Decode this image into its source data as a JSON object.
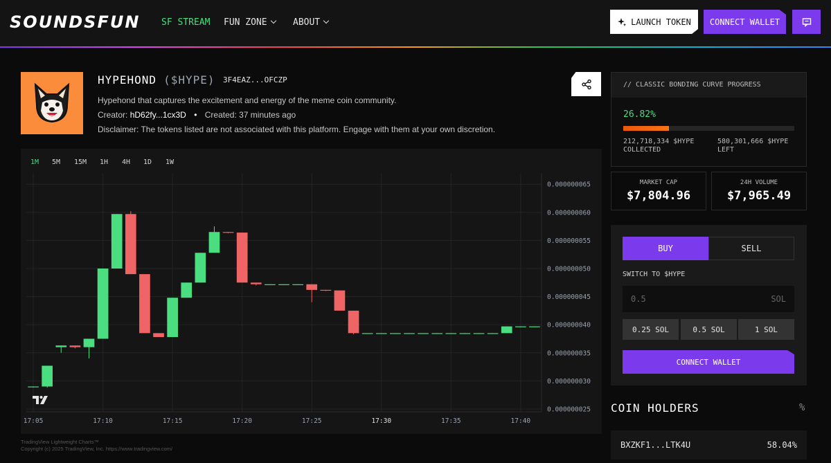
{
  "header": {
    "logo": "SOUNDSFUN",
    "nav": [
      {
        "label": "SF STREAM"
      },
      {
        "label": "FUN ZONE"
      },
      {
        "label": "ABOUT"
      }
    ],
    "launch_label": "LAUNCH TOKEN",
    "connect_label": "CONNECT WALLET"
  },
  "token": {
    "name": "HYPEHOND",
    "ticker": "($HYPE)",
    "address": "3F4EAZ...OFCZP",
    "description": "Hypehond that captures the excitement and energy of the meme coin community.",
    "creator_label": "Creator:",
    "creator": "hD62fy...1cx3D",
    "created_label": "Created:",
    "created": "37 minutes ago",
    "disclaimer": "Disclaimer: The tokens listed are not associated with this platform. Engage with them at your own discretion."
  },
  "timeframes": [
    "1M",
    "5M",
    "15M",
    "1H",
    "4H",
    "1D",
    "1W"
  ],
  "credits": {
    "line1": "TradingView Lightweight Charts™",
    "line2": "Copyright (c) 2025 TradingView, Inc. https://www.tradingview.com/"
  },
  "bonding": {
    "title": "// CLASSIC BONDING CURVE PROGRESS",
    "percent_text": "26.82%",
    "percent": 26.82,
    "collected_amount": "212,718,334 $HYPE",
    "collected_label": "COLLECTED",
    "left_amount": "580,301,666 $HYPE",
    "left_label": "LEFT"
  },
  "stats": {
    "market_cap_label": "MARKET CAP",
    "market_cap": "$7,804.96",
    "volume_label": "24H VOLUME",
    "volume": "$7,965.49"
  },
  "trade": {
    "buy_label": "BUY",
    "sell_label": "SELL",
    "switch_label": "SWITCH TO $HYPE",
    "amount_placeholder": "0.5",
    "amount_unit": "SOL",
    "quick": [
      "0.25 SOL",
      "0.5 SOL",
      "1 SOL"
    ],
    "connect_label": "CONNECT WALLET"
  },
  "holders": {
    "title": "COIN HOLDERS",
    "pct_symbol": "%",
    "rows": [
      {
        "address": "BXZKF1...LTK4U",
        "percent": "58.04%"
      }
    ]
  },
  "colors": {
    "accent": "#7c3aed",
    "up": "#4ade80",
    "down": "#ef6464"
  },
  "chart_data": {
    "type": "candlestick",
    "y_ticks": [
      "0.000000065",
      "0.000000060",
      "0.000000055",
      "0.000000050",
      "0.000000045",
      "0.000000040",
      "0.000000035",
      "0.000000030",
      "0.000000025"
    ],
    "x_ticks": [
      "17:05",
      "17:10",
      "17:15",
      "17:20",
      "17:25",
      "17:30",
      "17:35",
      "17:40"
    ],
    "ylim": [
      2.45e-08,
      6.7e-08
    ],
    "candles": [
      {
        "t": "17:05",
        "o": 2.9e-08,
        "h": 2.9e-08,
        "l": 2.88e-08,
        "c": 2.9e-08
      },
      {
        "t": "17:06",
        "o": 2.9e-08,
        "h": 3.27e-08,
        "l": 2.88e-08,
        "c": 3.27e-08
      },
      {
        "t": "17:07",
        "o": 3.6e-08,
        "h": 3.63e-08,
        "l": 3.5e-08,
        "c": 3.63e-08
      },
      {
        "t": "17:08",
        "o": 3.63e-08,
        "h": 3.63e-08,
        "l": 3.58e-08,
        "c": 3.6e-08
      },
      {
        "t": "17:09",
        "o": 3.6e-08,
        "h": 3.75e-08,
        "l": 3.4e-08,
        "c": 3.75e-08
      },
      {
        "t": "17:10",
        "o": 3.75e-08,
        "h": 5e-08,
        "l": 3.75e-08,
        "c": 5e-08
      },
      {
        "t": "17:11",
        "o": 5e-08,
        "h": 5.97e-08,
        "l": 5e-08,
        "c": 5.97e-08
      },
      {
        "t": "17:12",
        "o": 5.97e-08,
        "h": 6.02e-08,
        "l": 4.9e-08,
        "c": 4.9e-08
      },
      {
        "t": "17:13",
        "o": 4.9e-08,
        "h": 4.9e-08,
        "l": 3.85e-08,
        "c": 3.85e-08
      },
      {
        "t": "17:14",
        "o": 3.85e-08,
        "h": 3.85e-08,
        "l": 3.78e-08,
        "c": 3.78e-08
      },
      {
        "t": "17:15",
        "o": 3.78e-08,
        "h": 4.48e-08,
        "l": 3.78e-08,
        "c": 4.48e-08
      },
      {
        "t": "17:16",
        "o": 4.48e-08,
        "h": 4.75e-08,
        "l": 4.48e-08,
        "c": 4.75e-08
      },
      {
        "t": "17:17",
        "o": 4.75e-08,
        "h": 5.28e-08,
        "l": 4.75e-08,
        "c": 5.28e-08
      },
      {
        "t": "17:18",
        "o": 5.28e-08,
        "h": 5.75e-08,
        "l": 5.28e-08,
        "c": 5.65e-08
      },
      {
        "t": "17:19",
        "o": 5.65e-08,
        "h": 5.65e-08,
        "l": 5.63e-08,
        "c": 5.64e-08
      },
      {
        "t": "17:20",
        "o": 5.64e-08,
        "h": 5.64e-08,
        "l": 4.75e-08,
        "c": 4.75e-08
      },
      {
        "t": "17:21",
        "o": 4.75e-08,
        "h": 4.75e-08,
        "l": 4.7e-08,
        "c": 4.72e-08
      },
      {
        "t": "17:22",
        "o": 4.72e-08,
        "h": 4.72e-08,
        "l": 4.71e-08,
        "c": 4.72e-08
      },
      {
        "t": "17:23",
        "o": 4.72e-08,
        "h": 4.72e-08,
        "l": 4.71e-08,
        "c": 4.72e-08
      },
      {
        "t": "17:24",
        "o": 4.72e-08,
        "h": 4.72e-08,
        "l": 4.71e-08,
        "c": 4.72e-08
      },
      {
        "t": "17:25",
        "o": 4.72e-08,
        "h": 4.72e-08,
        "l": 4.4e-08,
        "c": 4.62e-08
      },
      {
        "t": "17:26",
        "o": 4.62e-08,
        "h": 4.62e-08,
        "l": 4.6e-08,
        "c": 4.61e-08
      },
      {
        "t": "17:27",
        "o": 4.61e-08,
        "h": 4.61e-08,
        "l": 4.25e-08,
        "c": 4.25e-08
      },
      {
        "t": "17:28",
        "o": 4.25e-08,
        "h": 4.25e-08,
        "l": 3.83e-08,
        "c": 3.85e-08
      },
      {
        "t": "17:29",
        "o": 3.85e-08,
        "h": 3.85e-08,
        "l": 3.84e-08,
        "c": 3.85e-08
      },
      {
        "t": "17:30",
        "o": 3.85e-08,
        "h": 3.85e-08,
        "l": 3.84e-08,
        "c": 3.85e-08
      },
      {
        "t": "17:31",
        "o": 3.85e-08,
        "h": 3.85e-08,
        "l": 3.84e-08,
        "c": 3.85e-08
      },
      {
        "t": "17:32",
        "o": 3.85e-08,
        "h": 3.85e-08,
        "l": 3.84e-08,
        "c": 3.85e-08
      },
      {
        "t": "17:33",
        "o": 3.85e-08,
        "h": 3.85e-08,
        "l": 3.84e-08,
        "c": 3.85e-08
      },
      {
        "t": "17:34",
        "o": 3.85e-08,
        "h": 3.85e-08,
        "l": 3.84e-08,
        "c": 3.85e-08
      },
      {
        "t": "17:35",
        "o": 3.85e-08,
        "h": 3.85e-08,
        "l": 3.84e-08,
        "c": 3.85e-08
      },
      {
        "t": "17:36",
        "o": 3.85e-08,
        "h": 3.85e-08,
        "l": 3.84e-08,
        "c": 3.85e-08
      },
      {
        "t": "17:37",
        "o": 3.85e-08,
        "h": 3.85e-08,
        "l": 3.84e-08,
        "c": 3.85e-08
      },
      {
        "t": "17:38",
        "o": 3.85e-08,
        "h": 3.85e-08,
        "l": 3.84e-08,
        "c": 3.85e-08
      },
      {
        "t": "17:39",
        "o": 3.85e-08,
        "h": 3.97e-08,
        "l": 3.85e-08,
        "c": 3.97e-08
      },
      {
        "t": "17:40",
        "o": 3.97e-08,
        "h": 3.97e-08,
        "l": 3.96e-08,
        "c": 3.97e-08
      },
      {
        "t": "17:41",
        "o": 3.97e-08,
        "h": 3.97e-08,
        "l": 3.96e-08,
        "c": 3.97e-08
      }
    ]
  }
}
